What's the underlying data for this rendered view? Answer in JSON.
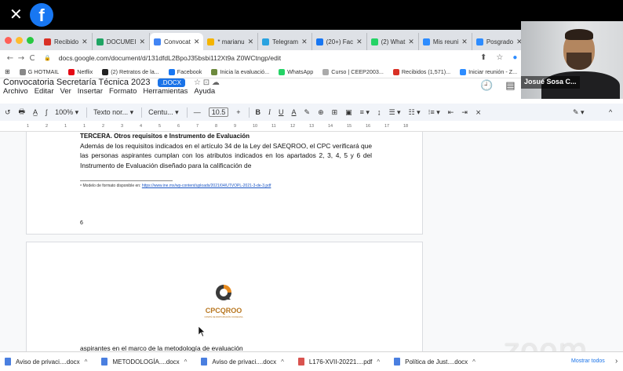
{
  "zoom": {
    "close_glyph": "✕",
    "fb_letter": "f",
    "watermark": "zoom"
  },
  "traffic_colors": [
    "#ff5f57",
    "#febc2e",
    "#28c840"
  ],
  "tabs": [
    {
      "label": "Recibido",
      "color": "#d93025",
      "active": false
    },
    {
      "label": "DOCUMEI",
      "color": "#1fa463",
      "active": false
    },
    {
      "label": "Convocat",
      "color": "#4285f4",
      "active": true
    },
    {
      "label": "* marianu",
      "color": "#f4b400",
      "active": false
    },
    {
      "label": "Telegram",
      "color": "#2aa3e0",
      "active": false
    },
    {
      "label": "(20+) Fac",
      "color": "#1877f2",
      "active": false
    },
    {
      "label": "(2) What",
      "color": "#25d366",
      "active": false
    },
    {
      "label": "Mis reuni",
      "color": "#2d8cff",
      "active": false
    },
    {
      "label": "Posgrado",
      "color": "#2d8cff",
      "active": false
    }
  ],
  "tab_close_glyph": "✕",
  "address": {
    "back": "←",
    "forward": "→",
    "reload": "C",
    "lock": "🔒",
    "url": "docs.google.com/document/d/131dfdL2BpoJ35bsbi112Xt9a Z0WCtngp/edit",
    "right_icons": [
      "⬆",
      "☆",
      "●"
    ]
  },
  "bookmarks": [
    {
      "label": "G HOTMAIL",
      "color": "#888888"
    },
    {
      "label": "Netflix",
      "color": "#e50914"
    },
    {
      "label": "(2) Retratos de la...",
      "color": "#222222"
    },
    {
      "label": "Facebook",
      "color": "#1877f2"
    },
    {
      "label": "Inicia la evaluació...",
      "color": "#6d8a3d"
    },
    {
      "label": "WhatsApp",
      "color": "#25d366"
    },
    {
      "label": "Curso | CEEP2003...",
      "color": "#aaaaaa"
    },
    {
      "label": "Recibidos (1,571)...",
      "color": "#d93025"
    },
    {
      "label": "Iniciar reunión - Z...",
      "color": "#2d8cff"
    }
  ],
  "docs": {
    "title": "Convocatoria Secretaría Técnica 2023",
    "badge": ".DOCX",
    "title_icons": "☆  ⊡  ☁",
    "menu": [
      "Archivo",
      "Editar",
      "Ver",
      "Insertar",
      "Formato",
      "Herramientas",
      "Ayuda"
    ],
    "right_icons": [
      "🕘",
      "▤"
    ]
  },
  "toolbar": {
    "items": [
      "↺",
      "🖶",
      "A̲",
      "ʃ",
      "100%  ▾",
      "Texto nor...  ▾",
      "Centu...  ▾"
    ],
    "minus": "—",
    "font_size": "10.5",
    "plus": "+",
    "bold": "B",
    "italic": "I",
    "underline": "U",
    "color": "A",
    "tail": [
      "✎",
      "⊕",
      "⊞",
      "▣",
      "≡ ▾",
      "↨",
      "☰ ▾",
      "☷ ▾",
      "⁝≡ ▾",
      "⇤",
      "⇥",
      "⨯"
    ],
    "pen": "✎ ▾",
    "collapse": "^"
  },
  "ruler_marks": [
    "1",
    "2",
    "1",
    "1",
    "2",
    "3",
    "4",
    "5",
    "6",
    "7",
    "8",
    "9",
    "10",
    "11",
    "12",
    "13",
    "14",
    "15",
    "16",
    "17",
    "18"
  ],
  "page1": {
    "heading": "TERCERA. Otros requisitos e Instrumento de Evaluación",
    "body": "Además de los requisitos indicados en el artículo 34 de la Ley del SAEQROO, el CPC verificará que las personas aspirantes cumplan con los atributos indicados en los apartados 2, 3, 4, 5 y 6 del Instrumento de Evaluación diseñado para la calificación de",
    "footnote_prefix": "⁸ Modelo de formato disponible en: ",
    "footnote_link": "https://www.ine.mx/wp-content/uploads/2021/04/UTVOPL-2021-3-de-3.pdf",
    "page_number": "6"
  },
  "page2": {
    "logo_text": "CPCQROO",
    "logo_sub": "COMITÉ DE PARTICIPACIÓN CIUDADANA",
    "logo_color": "#b8761f",
    "text": "aspirantes en el marco de la metodología de evaluación"
  },
  "video": {
    "name": "Josué Sosa C..."
  },
  "downloads": {
    "items": [
      {
        "label": "Aviso de privaci....docx",
        "type": "docx"
      },
      {
        "label": "METODOLOGÍA....docx",
        "type": "docx"
      },
      {
        "label": "Aviso de privaci....docx",
        "type": "docx"
      },
      {
        "label": "L176-XVII-20221....pdf",
        "type": "pdf"
      },
      {
        "label": "Política de Just....docx",
        "type": "docx"
      }
    ],
    "chev": "^",
    "show_all": "Mostrar todos",
    "next": "›"
  }
}
